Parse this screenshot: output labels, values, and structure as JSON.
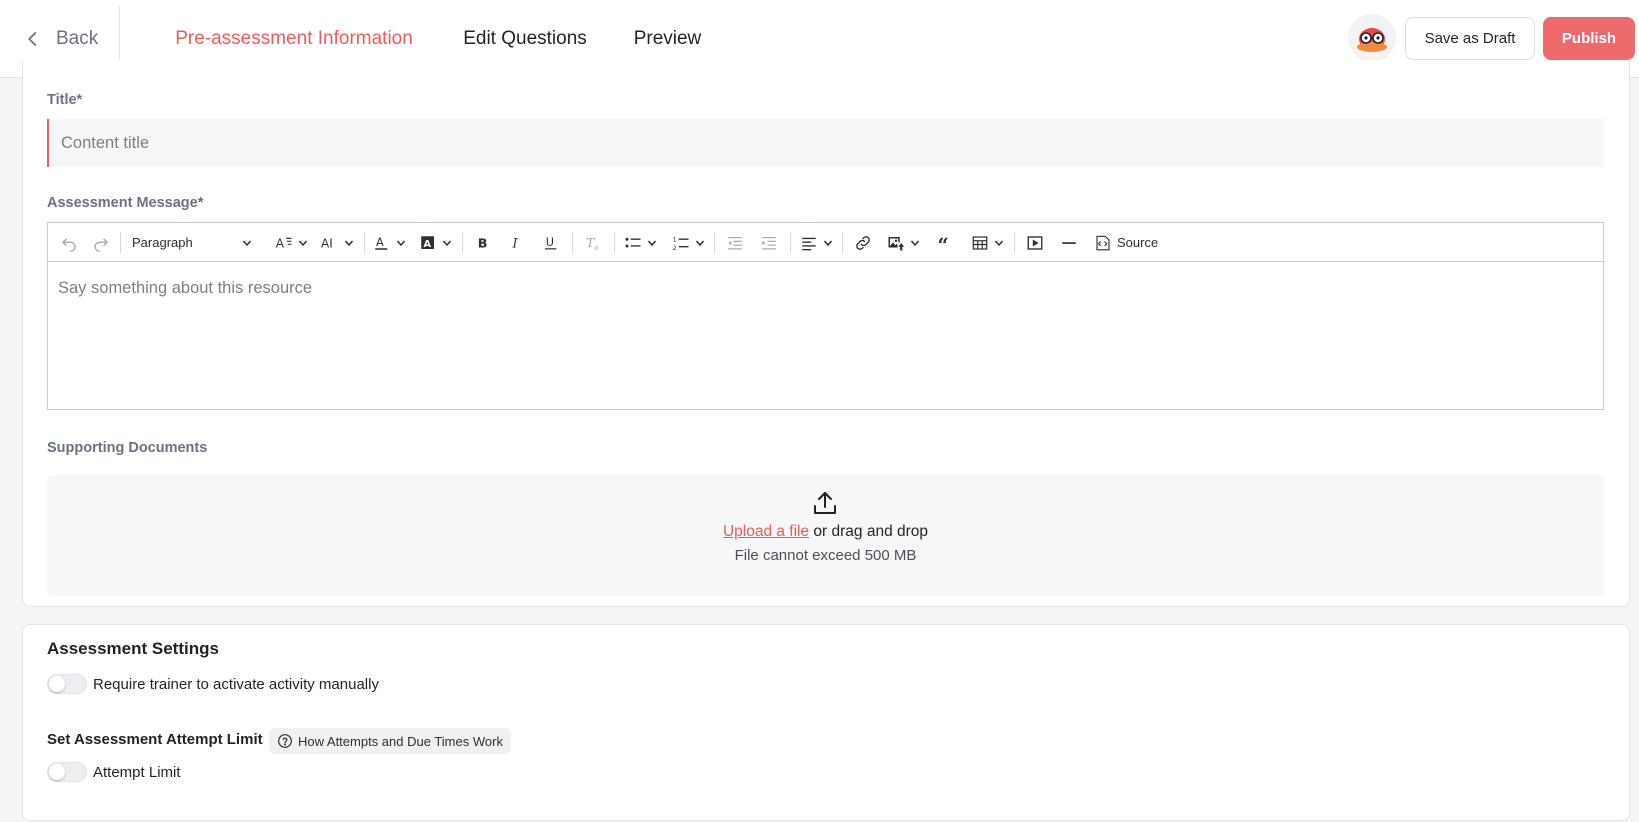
{
  "header": {
    "back_label": "Back",
    "tabs": [
      {
        "label": "Pre-assessment Information",
        "active": true
      },
      {
        "label": "Edit Questions",
        "active": false
      },
      {
        "label": "Preview",
        "active": false
      }
    ],
    "save_draft_label": "Save as Draft",
    "publish_label": "Publish",
    "accent_color": "#ef5b5b"
  },
  "form": {
    "title_label": "Title*",
    "title_placeholder": "Content title",
    "title_value": "",
    "message_label": "Assessment Message*",
    "editor": {
      "paragraph_select": "Paragraph",
      "source_label": "Source",
      "placeholder": "Say something about this resource",
      "toolbar_icons": [
        "undo-icon",
        "redo-icon",
        "font-size-icon",
        "font-family-icon",
        "font-color-icon",
        "font-background-icon",
        "bold-icon",
        "italic-icon",
        "underline-icon",
        "remove-format-icon",
        "bulleted-list-icon",
        "numbered-list-icon",
        "outdent-icon",
        "indent-icon",
        "align-icon",
        "link-icon",
        "insert-image-icon",
        "blockquote-icon",
        "insert-table-icon",
        "media-embed-icon",
        "horizontal-line-icon",
        "source-icon"
      ]
    },
    "documents_label": "Supporting Documents",
    "upload": {
      "link_text": "Upload a file",
      "rest_text": " or drag and drop",
      "limit_text": "File cannot exceed 500 MB"
    }
  },
  "settings": {
    "title": "Assessment Settings",
    "manual_activation_label": "Require trainer to activate activity manually",
    "manual_activation_on": false,
    "attempt_limit_title": "Set Assessment Attempt Limit",
    "help_link": "How Attempts and Due Times Work",
    "attempt_limit_label": "Attempt Limit",
    "attempt_limit_on": false
  }
}
